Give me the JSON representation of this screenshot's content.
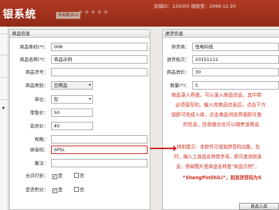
{
  "header": {
    "brand": "银系统",
    "version": "专业版10.1",
    "stars": "★★★★★",
    "shop_info": "店铺ID：125005 授权至：2099-12-30"
  },
  "product_panel": {
    "title": "商品信息",
    "fields": {
      "code": {
        "label": "商品条码(*)：",
        "value": "008"
      },
      "name": {
        "label": "商品名称(*)：",
        "value": "商品示例"
      },
      "item_no": {
        "label": "商品货号：",
        "value": ""
      },
      "category": {
        "label": "商品类别：",
        "value": "日用品"
      },
      "unit": {
        "label": "单位：",
        "value": "包"
      },
      "retail_price": {
        "label": "零售价：",
        "value": "50"
      },
      "member_price": {
        "label": "会员价：",
        "value": "40"
      },
      "spec": {
        "label": "规格：",
        "value": ""
      },
      "pinyin": {
        "label": "拼音码：",
        "value": "SPSL"
      },
      "remark": {
        "label": "备注：",
        "value": ""
      }
    },
    "allow_discount": {
      "label": "允许打折：",
      "yes": "是",
      "no": "否",
      "yes_checked": "✓"
    },
    "points": {
      "label": "是否积分：",
      "yes": "是",
      "no": "否",
      "yes_checked": "✓"
    }
  },
  "purchase_panel": {
    "title": "进货信息",
    "fields": {
      "supplier": {
        "label": "供货商：",
        "value": "怪电科技"
      },
      "batch": {
        "label": "进货批次：",
        "value": "20151111"
      },
      "purchase_price": {
        "label": "商品进价：",
        "value": "30"
      },
      "quantity": {
        "label": "数量(*)：",
        "value": "5"
      }
    }
  },
  "notes": {
    "intro": [
      "商品录入界面，可以录入商品信息。其中带",
      "必须填写的。输入完商品信息后，点击下方",
      "钮即可完成入库，点击商品浏览界面即可查",
      "的信息，在收银台也可以销售该商品"
    ],
    "tip": [
      "特别提示：本软件已增加拼音码功能，在",
      "时，输入上商品名称首字母，即可查询到该",
      "息，例如图片里商品名称是“商品示例”，",
      "“ShangPinShiLi”，则其拼音码为S"
    ]
  },
  "footer": {
    "save_button": "商品入库"
  }
}
